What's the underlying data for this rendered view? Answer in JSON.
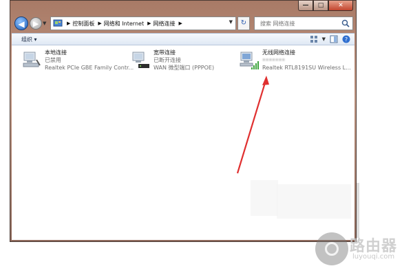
{
  "window": {
    "caption_buttons": {
      "minimize": "—",
      "maximize": "□",
      "close": "✕"
    }
  },
  "navigation": {
    "breadcrumbs": [
      "控制面板",
      "网络和 Internet",
      "网络连接"
    ],
    "search_placeholder": "搜索 网络连接"
  },
  "toolbar": {
    "organize_label": "组织 ▾"
  },
  "connections": [
    {
      "name": "本地连接",
      "status": "已禁用",
      "device": "Realtek PCIe GBE Family Contr..."
    },
    {
      "name": "宽带连接",
      "status": "已断开连接",
      "device": "WAN 微型端口 (PPPOE)"
    },
    {
      "name": "无线网络连接",
      "status": "•••••••",
      "device": "Realtek RTL8191SU Wireless L..."
    }
  ],
  "annotation": {
    "arrow_color": "#e03030"
  },
  "watermark": {
    "title": "路由器",
    "url": "luyouqi.com"
  }
}
